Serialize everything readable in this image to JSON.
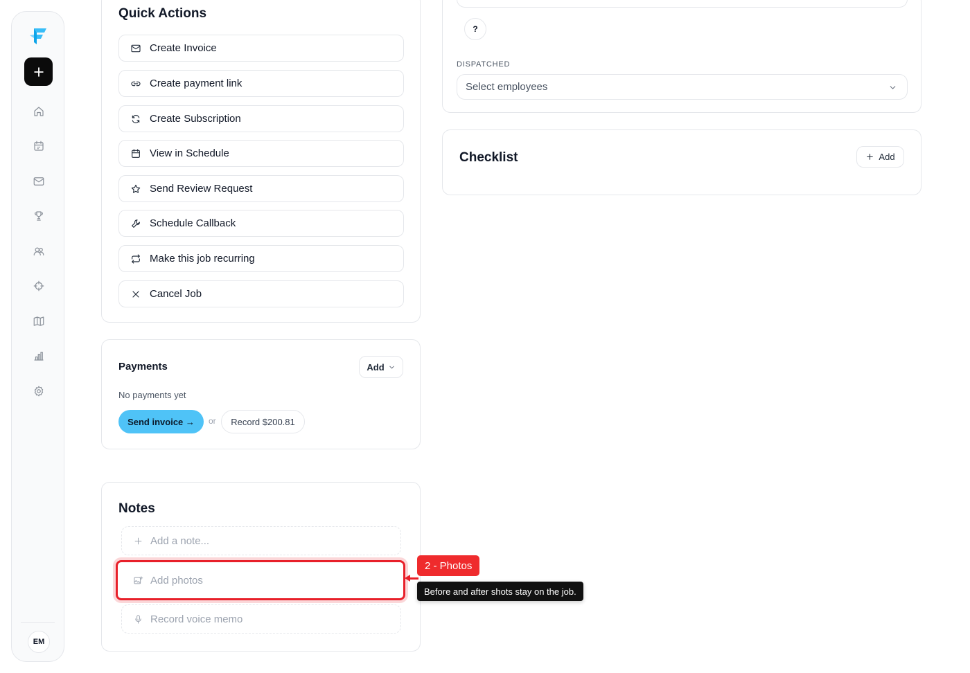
{
  "sidebar": {
    "brand_color": "#38bdf8",
    "new_button_icon": "plus-icon",
    "nav_items": [
      {
        "icon": "home-icon"
      },
      {
        "icon": "calendar-icon"
      },
      {
        "icon": "mail-icon"
      },
      {
        "icon": "trophy-icon"
      },
      {
        "icon": "users-icon"
      },
      {
        "icon": "crosshair-icon"
      },
      {
        "icon": "map-icon"
      },
      {
        "icon": "bar-chart-icon"
      },
      {
        "icon": "gear-icon"
      }
    ],
    "avatar_initials": "EM"
  },
  "quick_actions": {
    "title": "Quick Actions",
    "items": [
      {
        "label": "Create Invoice",
        "icon": "mail-icon"
      },
      {
        "label": "Create payment link",
        "icon": "link-icon"
      },
      {
        "label": "Create Subscription",
        "icon": "refresh-icon"
      },
      {
        "label": "View in Schedule",
        "icon": "calendar-icon"
      },
      {
        "label": "Send Review Request",
        "icon": "star-icon"
      },
      {
        "label": "Schedule Callback",
        "icon": "wrench-icon"
      },
      {
        "label": "Make this job recurring",
        "icon": "repeat-icon"
      },
      {
        "label": "Cancel Job",
        "icon": "close-icon"
      }
    ]
  },
  "payments": {
    "title": "Payments",
    "add_label": "Add",
    "empty_text": "No payments yet",
    "send_invoice_label": "Send invoice →",
    "or_text": "or",
    "record_label": "Record $200.81",
    "accent_color": "#4fc3f7"
  },
  "notes": {
    "title": "Notes",
    "add_note_label": "Add a note...",
    "add_photos_label": "Add photos",
    "record_memo_label": "Record voice memo"
  },
  "callout": {
    "badge": "2 - Photos",
    "tooltip": "Before and after shots stay on the job.",
    "color": "#ef2b2d"
  },
  "job_details": {
    "help_label": "?",
    "dispatched_label": "DISPATCHED",
    "employees_placeholder": "Select employees"
  },
  "checklist": {
    "title": "Checklist",
    "add_label": "Add"
  }
}
